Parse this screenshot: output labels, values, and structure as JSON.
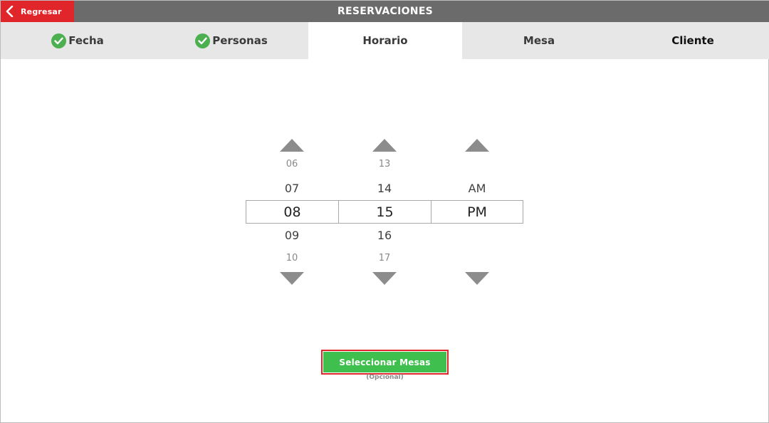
{
  "topbar": {
    "back_label": "Regresar",
    "title": "RESERVACIONES"
  },
  "tabs": [
    {
      "label": "Fecha",
      "completed": true
    },
    {
      "label": "Personas",
      "completed": true
    },
    {
      "label": "Horario",
      "completed": false,
      "active": true
    },
    {
      "label": "Mesa",
      "completed": false
    },
    {
      "label": "Cliente",
      "completed": false
    }
  ],
  "time_picker": {
    "hour": {
      "above2": "06",
      "above1": "07",
      "selected": "08",
      "below1": "09",
      "below2": "10"
    },
    "minute": {
      "above2": "13",
      "above1": "14",
      "selected": "15",
      "below1": "16",
      "below2": "17"
    },
    "period": {
      "above1": "AM",
      "selected": "PM"
    }
  },
  "actions": {
    "select_tables_label": "Seleccionar Mesas",
    "optional_note": "(Opcional)"
  },
  "colors": {
    "accent_red": "#e0262a",
    "topbar_gray": "#6b6b6b",
    "success_green": "#3fbf4d",
    "check_green": "#4caf50"
  }
}
